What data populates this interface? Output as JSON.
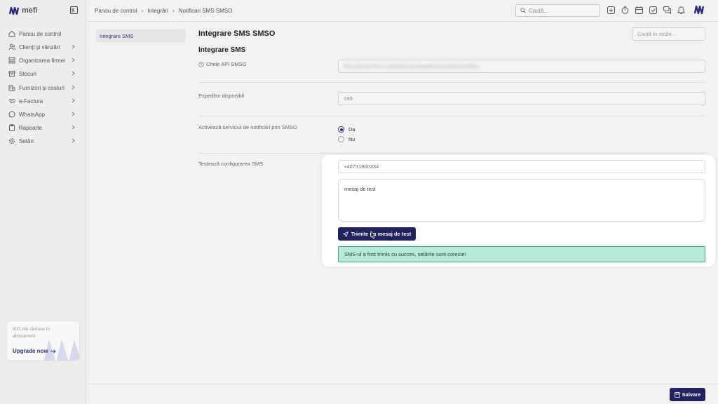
{
  "brand": {
    "name": "mefi",
    "accent": "#22225f"
  },
  "sidebar": {
    "items": [
      {
        "label": "Panou de control",
        "icon": "home-icon",
        "has_chevron": false
      },
      {
        "label": "Clienți și vânzări",
        "icon": "users-icon",
        "has_chevron": true
      },
      {
        "label": "Organizarea firmei",
        "icon": "org-icon",
        "has_chevron": true
      },
      {
        "label": "Stocuri",
        "icon": "box-icon",
        "has_chevron": true
      },
      {
        "label": "Furnizori și costuri",
        "icon": "building-icon",
        "has_chevron": true
      },
      {
        "label": "e-Factura",
        "icon": "handshake-icon",
        "has_chevron": true
      },
      {
        "label": "WhatsApp",
        "icon": "whatsapp-icon",
        "has_chevron": true
      },
      {
        "label": "Rapoarte",
        "icon": "clipboard-icon",
        "has_chevron": true
      },
      {
        "label": "Setări",
        "icon": "gear-icon",
        "has_chevron": true
      }
    ],
    "upgrade": {
      "note": "600 zile rămase în abonament",
      "link": "Upgrade now"
    }
  },
  "breadcrumb": [
    "Panou de control",
    "Integrări",
    "Notificari SMS SMSO"
  ],
  "search": {
    "placeholder": "Caută..."
  },
  "subnav": {
    "active": "Integrare SMS"
  },
  "page": {
    "title": "Integrare SMS SMSO",
    "section": "Integrare SMS",
    "settings_search_placeholder": "Caută în setări..."
  },
  "fields": {
    "api_key": {
      "label": "Cheie API SMSO",
      "value": "8f2ca9f1b23f4ccc48af9d014a3f8d05ab2b3f4bcde4f8bd"
    },
    "sender": {
      "label": "Expeditor disponibil",
      "value": "190"
    },
    "activate": {
      "label": "Activează serviciul de notificări prin SMSO",
      "options": [
        "Da",
        "Nu"
      ],
      "selected": "Da"
    },
    "test": {
      "label": "Testează configurarea SMS",
      "phone": "+40731860334",
      "message": "mesaj de test",
      "button": "Trimite un mesaj de test",
      "success": "SMS-ul a fost trimis cu succes, setările sunt corecte!",
      "success_bg": "#b8eadb",
      "success_border": "#3f9e80"
    }
  },
  "footer": {
    "save": "Salvare"
  }
}
